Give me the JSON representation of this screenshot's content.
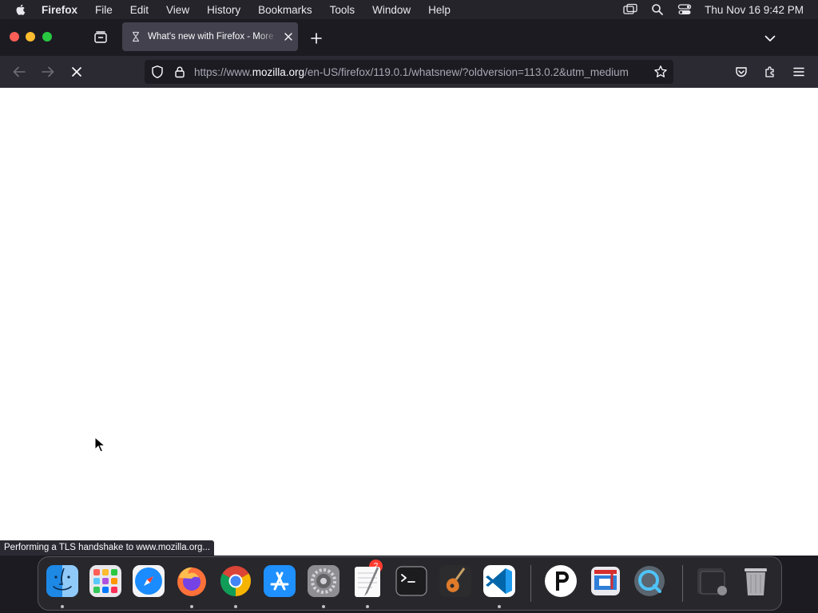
{
  "menubar": {
    "app_name": "Firefox",
    "items": [
      "File",
      "Edit",
      "View",
      "History",
      "Bookmarks",
      "Tools",
      "Window",
      "Help"
    ],
    "clock": "Thu Nov 16  9:42 PM"
  },
  "tab": {
    "title": "What's new with Firefox - More"
  },
  "urlbar": {
    "url_prefix": "https://www.",
    "url_host": "mozilla.org",
    "url_rest": "/en-US/firefox/119.0.1/whatsnew/?oldversion=113.0.2&utm_medium"
  },
  "status": {
    "text": "Performing a TLS handshake to www.mozilla.org..."
  },
  "dock": {
    "settings_badge": "2"
  },
  "colors": {
    "tab_bg": "#42414d",
    "toolbar_bg": "#2b2a33",
    "urlbar_bg": "#1c1b22"
  }
}
